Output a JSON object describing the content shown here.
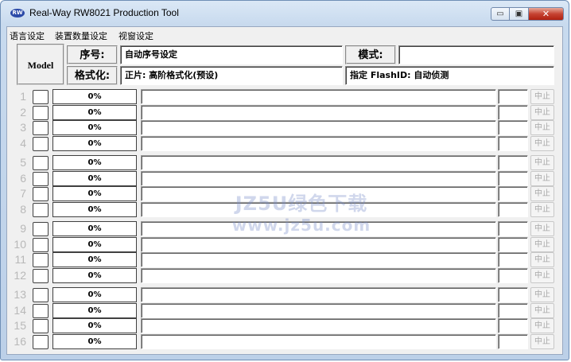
{
  "window": {
    "title": "Real-Way RW8021 Production Tool",
    "icon_text": "RW",
    "min_glyph": "▭",
    "max_glyph": "▣",
    "close_glyph": "✕"
  },
  "menu": [
    "语言设定",
    "装置数量设定",
    "视窗设定"
  ],
  "header": {
    "model_label": "Model",
    "serial_label": "序号:",
    "serial_value": "自动序号设定",
    "mode_label": "模式:",
    "mode_value": "",
    "format_label": "格式化:",
    "format_value": "正片: 高阶格式化(预设)",
    "flash_value": "指定 FlashID: 自动侦测"
  },
  "rows": [
    {
      "num": "1",
      "pct_text": "0%",
      "progress": 0,
      "stop": "中止"
    },
    {
      "num": "2",
      "pct_text": "0%",
      "progress": 0,
      "stop": "中止"
    },
    {
      "num": "3",
      "pct_text": "0%",
      "progress": 0,
      "stop": "中止"
    },
    {
      "num": "4",
      "pct_text": "0%",
      "progress": 0,
      "stop": "中止"
    },
    {
      "num": "5",
      "pct_text": "0%",
      "progress": 0,
      "stop": "中止"
    },
    {
      "num": "6",
      "pct_text": "0%",
      "progress": 0,
      "stop": "中止"
    },
    {
      "num": "7",
      "pct_text": "0%",
      "progress": 0,
      "stop": "中止"
    },
    {
      "num": "8",
      "pct_text": "0%",
      "progress": 0,
      "stop": "中止"
    },
    {
      "num": "9",
      "pct_text": "0%",
      "progress": 0,
      "stop": "中止"
    },
    {
      "num": "10",
      "pct_text": "0%",
      "progress": 0,
      "stop": "中止"
    },
    {
      "num": "11",
      "pct_text": "0%",
      "progress": 0,
      "stop": "中止"
    },
    {
      "num": "12",
      "pct_text": "0%",
      "progress": 0,
      "stop": "中止"
    },
    {
      "num": "13",
      "pct_text": "0%",
      "progress": 0,
      "stop": "中止"
    },
    {
      "num": "14",
      "pct_text": "0%",
      "progress": 0,
      "stop": "中止"
    },
    {
      "num": "15",
      "pct_text": "0%",
      "progress": 0,
      "stop": "中止"
    },
    {
      "num": "16",
      "pct_text": "0%",
      "progress": 0,
      "stop": "中止"
    }
  ],
  "watermark": {
    "line1": "JZ5U绿色下载",
    "line2": "www.jz5u.com"
  }
}
